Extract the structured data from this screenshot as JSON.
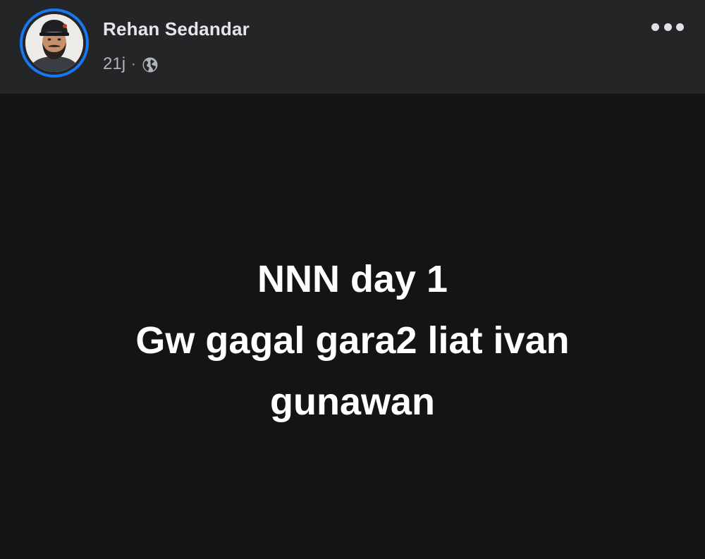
{
  "post": {
    "author": {
      "name": "Rehan Sedandar"
    },
    "meta": {
      "time": "21j",
      "separator": "·",
      "audience_icon": "globe-icon"
    },
    "more_icon": "more-horizontal-icon",
    "text_lines": [
      "NNN day 1",
      "Gw gagal gara2 liat ivan",
      "gunawan"
    ]
  },
  "colors": {
    "header_bg": "#242526",
    "body_bg": "#141415",
    "avatar_ring": "#1877f2",
    "name_text": "#e4e6eb",
    "meta_text": "#b0b3b8",
    "post_text": "#ffffff"
  }
}
